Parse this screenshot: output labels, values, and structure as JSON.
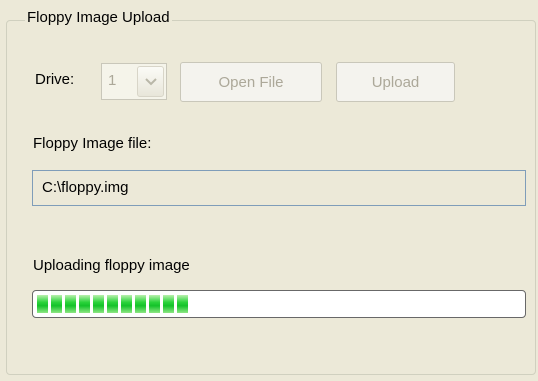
{
  "group": {
    "title": "Floppy Image Upload"
  },
  "drive": {
    "label": "Drive:",
    "value": "1"
  },
  "buttons": {
    "open_file": "Open File",
    "upload": "Upload"
  },
  "file": {
    "label": "Floppy Image file:",
    "path": "C:\\floppy.img"
  },
  "progress": {
    "label": "Uploading floppy image",
    "fraction": 0.34,
    "segments": 11
  },
  "colors": {
    "progress_fill": "#14c22a",
    "window_bg": "#ece9d8",
    "disabled_text": "#aca899"
  },
  "icons": {
    "combo_arrow": "chevron-down-icon"
  }
}
